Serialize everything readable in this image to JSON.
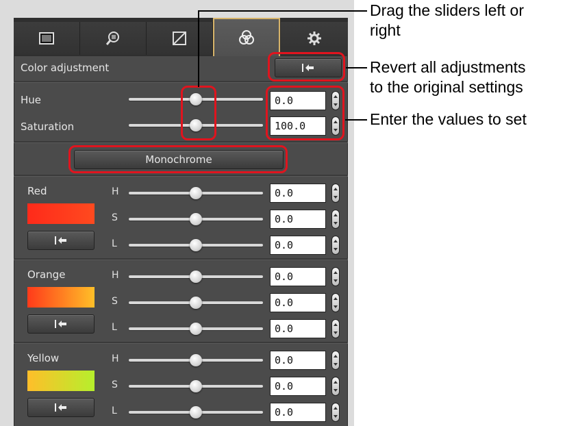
{
  "colors": {
    "panel_bg": "#4b4b4b",
    "highlight": "#e0141e",
    "active_tab_border": "#d7b46a"
  },
  "tabs": [
    {
      "icon": "picture-icon"
    },
    {
      "icon": "magnifier-grid-icon"
    },
    {
      "icon": "tone-curve-icon"
    },
    {
      "icon": "color-circles-icon",
      "active": true
    },
    {
      "icon": "gear-icon"
    }
  ],
  "color_adjustment": {
    "title": "Color adjustment",
    "hue": {
      "label": "Hue",
      "value": "0.0",
      "level": 0.5
    },
    "saturation": {
      "label": "Saturation",
      "value": "100.0",
      "level": 0.5
    },
    "monochrome_label": "Monochrome"
  },
  "channels": [
    {
      "name": "Red",
      "swatch_from": "#ff2a1a",
      "swatch_to": "#ff4a1f",
      "rows": [
        {
          "label": "H",
          "value": "0.0",
          "level": 0.5
        },
        {
          "label": "S",
          "value": "0.0",
          "level": 0.5
        },
        {
          "label": "L",
          "value": "0.0",
          "level": 0.5
        }
      ]
    },
    {
      "name": "Orange",
      "swatch_from": "#ff3a1a",
      "swatch_to": "#ffbf28",
      "rows": [
        {
          "label": "H",
          "value": "0.0",
          "level": 0.5
        },
        {
          "label": "S",
          "value": "0.0",
          "level": 0.5
        },
        {
          "label": "L",
          "value": "0.0",
          "level": 0.5
        }
      ]
    },
    {
      "name": "Yellow",
      "swatch_from": "#ffbe2a",
      "swatch_to": "#b6ef2c",
      "rows": [
        {
          "label": "H",
          "value": "0.0",
          "level": 0.5
        },
        {
          "label": "S",
          "value": "0.0",
          "level": 0.5
        },
        {
          "label": "L",
          "value": "0.0",
          "level": 0.5
        }
      ]
    }
  ],
  "annotations": {
    "drag_line1": "Drag the sliders left or",
    "drag_line2": "right",
    "revert_line1": "Revert all adjustments",
    "revert_line2": "to the original settings",
    "enter": "Enter the values to set"
  }
}
